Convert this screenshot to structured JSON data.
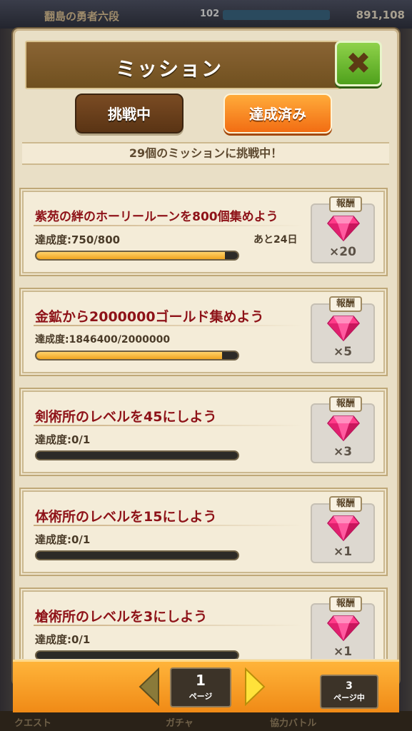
{
  "background": {
    "top_title": "翻島の勇者六段",
    "level_label": "102",
    "currency": "891,108",
    "bottom_labels": [
      "クエスト",
      "ガチャ",
      "協力バトル"
    ]
  },
  "panel": {
    "title": "ミッション",
    "close_icon": "close-x-icon",
    "tabs": [
      {
        "label": "挑戦中",
        "active": true
      },
      {
        "label": "達成済み",
        "active": false
      }
    ],
    "ribbon": "29個のミッションに挑戦中！"
  },
  "reward_tag": "報酬",
  "missions": [
    {
      "title": "紫苑の絆のホーリールーンを800個集めよう",
      "progress_label": "達成度:750/800",
      "remaining": "あと24日",
      "progress": 0.9375,
      "reward_qty": "×20"
    },
    {
      "title": "金鉱から2000000ゴールド集めよう",
      "progress_label": "達成度:1846400/2000000",
      "remaining": "",
      "progress": 0.9232,
      "reward_qty": "×5"
    },
    {
      "title": "剣術所のレベルを45にしよう",
      "progress_label": "達成度:0/1",
      "remaining": "",
      "progress": 0,
      "reward_qty": "×3"
    },
    {
      "title": "体術所のレベルを15にしよう",
      "progress_label": "達成度:0/1",
      "remaining": "",
      "progress": 0,
      "reward_qty": "×1"
    },
    {
      "title": "槍術所のレベルを3にしよう",
      "progress_label": "達成度:0/1",
      "remaining": "",
      "progress": 0,
      "reward_qty": "×1"
    }
  ],
  "pagination": {
    "current": "1",
    "current_unit": "ページ",
    "total": "3",
    "total_unit": "ページ中"
  },
  "colors": {
    "header_brown": "#7a5628",
    "mission_title_red": "#8e1218",
    "progress_fill": "#f0a520",
    "footer_orange": "#f59a20",
    "gem_pink": "#ff3c8a"
  }
}
